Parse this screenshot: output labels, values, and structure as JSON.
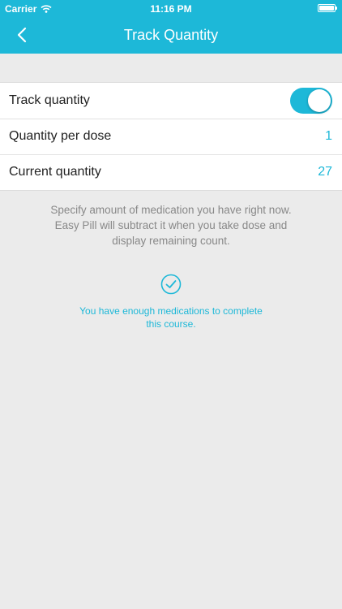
{
  "status_bar": {
    "carrier": "Carrier",
    "time": "11:16 PM"
  },
  "nav": {
    "title": "Track Quantity"
  },
  "settings": {
    "track_label": "Track quantity",
    "track_enabled": true,
    "dose_label": "Quantity per dose",
    "dose_value": "1",
    "current_label": "Current quantity",
    "current_value": "27"
  },
  "help_text": "Specify amount of medication you have right now. Easy Pill will subtract it when you take dose and display remaining count.",
  "status_message": "You have enough medications to complete this course.",
  "colors": {
    "accent": "#1db8d8",
    "background": "#ebebeb"
  },
  "icons": {
    "back": "chevron-left-icon",
    "check": "check-circle-icon",
    "wifi": "wifi-icon",
    "battery": "battery-icon"
  }
}
